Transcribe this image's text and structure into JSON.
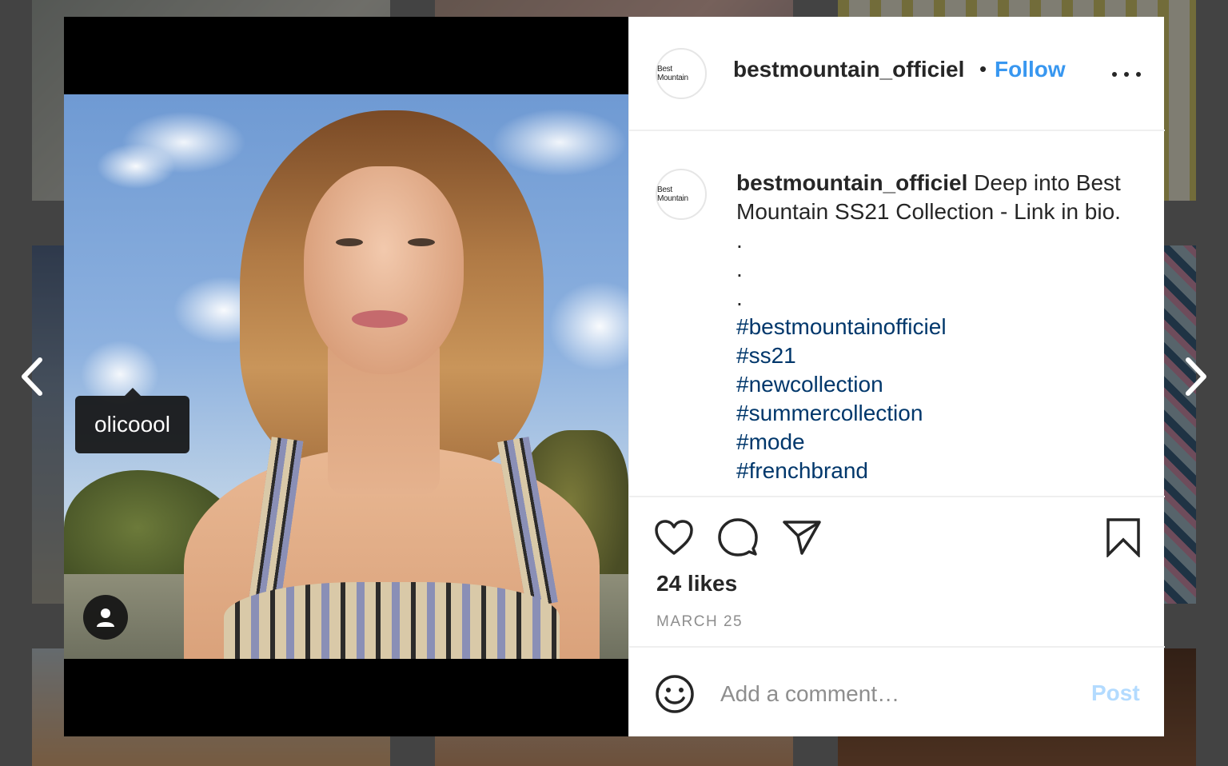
{
  "post": {
    "account": {
      "username": "bestmountain_officiel",
      "avatar_text": "Best Mountain",
      "follow_label": "Follow",
      "separator": "•"
    },
    "caption": {
      "username": "bestmountain_officiel",
      "text_line1": "Deep into Best",
      "text_line2": "Mountain SS21 Collection - Link in bio.",
      "dots": [
        ".",
        ".",
        "."
      ],
      "hashtags": [
        "#bestmountainofficiel",
        "#ss21",
        "#newcollection",
        "#summercollection",
        "#mode",
        "#frenchbrand"
      ]
    },
    "tagged_user": "olicoool",
    "likes_label": "24 likes",
    "date_label": "MARCH 25",
    "comment": {
      "placeholder": "Add a comment…",
      "post_label": "Post"
    }
  },
  "icons": {
    "more": "more-options-icon",
    "like": "heart-icon",
    "comment": "speech-bubble-icon",
    "share": "paper-plane-icon",
    "save": "bookmark-icon",
    "emoji": "smiley-icon",
    "user_tags": "person-icon",
    "prev": "chevron-left-icon",
    "next": "chevron-right-icon"
  },
  "colors": {
    "accent": "#3897f0",
    "hashtag": "#00376b",
    "muted": "#8e8e8e",
    "post_disabled": "#b3dbff"
  }
}
